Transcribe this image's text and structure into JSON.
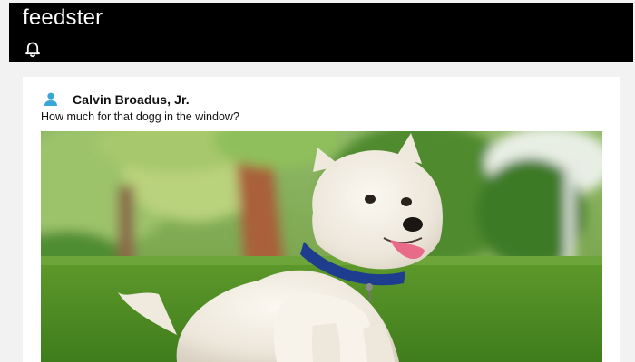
{
  "app": {
    "brand": "feedster"
  },
  "header": {
    "icons": [
      "bell-icon"
    ]
  },
  "post": {
    "author": "Calvin Broadus, Jr.",
    "text": "How much for that dogg in the window?",
    "avatar_icon": "person-icon",
    "image_subject": "white terrier dog on grass"
  },
  "colors": {
    "topbar": "#000000",
    "page_bg": "#f2f2f2",
    "card_bg": "#ffffff",
    "avatar_accent": "#3aa6d8"
  }
}
